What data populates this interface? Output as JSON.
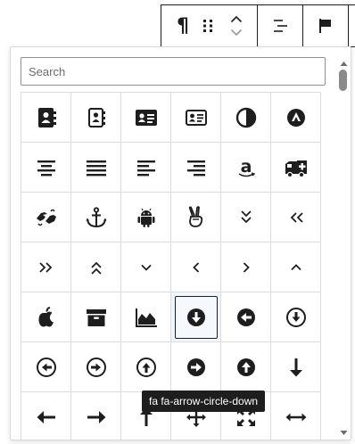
{
  "toolbar": {
    "paragraph_icon_glyph": "¶",
    "icons": [
      "paragraph-icon",
      "drag-handle-icon",
      "chevron-up-icon",
      "chevron-down-icon",
      "align-right-icon",
      "flag-icon"
    ]
  },
  "icon_picker": {
    "search": {
      "placeholder": "Search",
      "value": ""
    },
    "selected_index": 28,
    "tooltip": "fa fa-arrow-circle-down",
    "icons": [
      "address-book-icon",
      "address-book-outline-icon",
      "address-card-icon",
      "address-card-outline-icon",
      "adjust-icon",
      "adn-icon",
      "align-center-icon",
      "align-justify-icon",
      "align-left-icon",
      "align-right-icon",
      "amazon-icon",
      "ambulance-icon",
      "american-sign-language-interpreting-icon",
      "anchor-icon",
      "android-icon",
      "angellist-icon",
      "angle-double-down-icon",
      "angle-double-left-icon",
      "angle-double-right-icon",
      "angle-double-up-icon",
      "angle-down-icon",
      "angle-left-icon",
      "angle-right-icon",
      "angle-up-icon",
      "apple-icon",
      "archive-icon",
      "area-chart-icon",
      "arrow-circle-down-icon",
      "arrow-circle-left-icon",
      "arrow-circle-o-down-icon",
      "arrow-circle-o-left-icon",
      "arrow-circle-o-right-icon",
      "arrow-circle-o-up-icon",
      "arrow-circle-right-icon",
      "arrow-circle-up-icon",
      "arrow-down-icon",
      "arrow-left-icon",
      "arrow-right-icon",
      "arrow-up-icon",
      "arrows-icon",
      "arrows-alt-icon",
      "arrows-h-icon"
    ]
  },
  "colors": {
    "icon": "#1e1e1e",
    "border": "#dcdcdc",
    "tooltip_bg": "#1e1e1e",
    "selected_bg": "#f0f7ff"
  }
}
